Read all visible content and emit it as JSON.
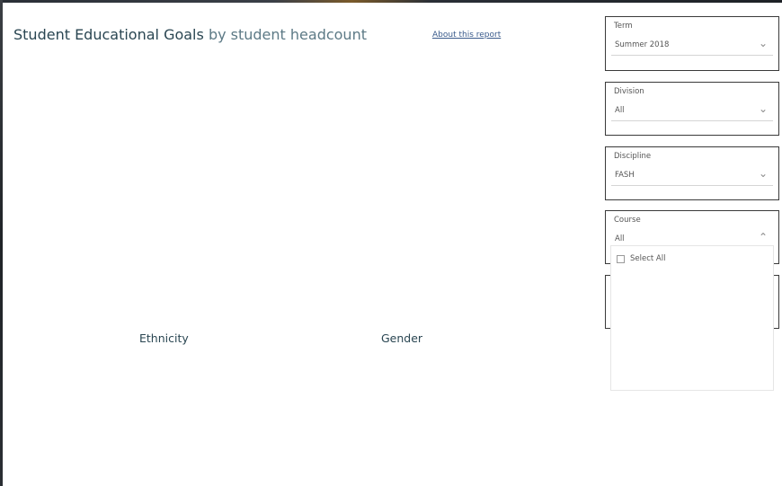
{
  "header": {
    "title_main": "Student Educational Goals",
    "title_sub": "by student headcount",
    "about_link": "About this report"
  },
  "slicers": {
    "term": {
      "label": "Term",
      "value": "Summer 2018"
    },
    "division": {
      "label": "Division",
      "value": "All"
    },
    "discipline": {
      "label": "Discipline",
      "value": "FASH"
    },
    "course": {
      "label": "Course",
      "value": "All",
      "options": [
        "Select All"
      ]
    }
  },
  "charts": {
    "ethnicity_label": "Ethnicity",
    "gender_label": "Gender"
  },
  "icons": {
    "chevron_down": "chevron-down-icon",
    "chevron_up": "chevron-up-icon",
    "checkbox": "checkbox-icon"
  }
}
